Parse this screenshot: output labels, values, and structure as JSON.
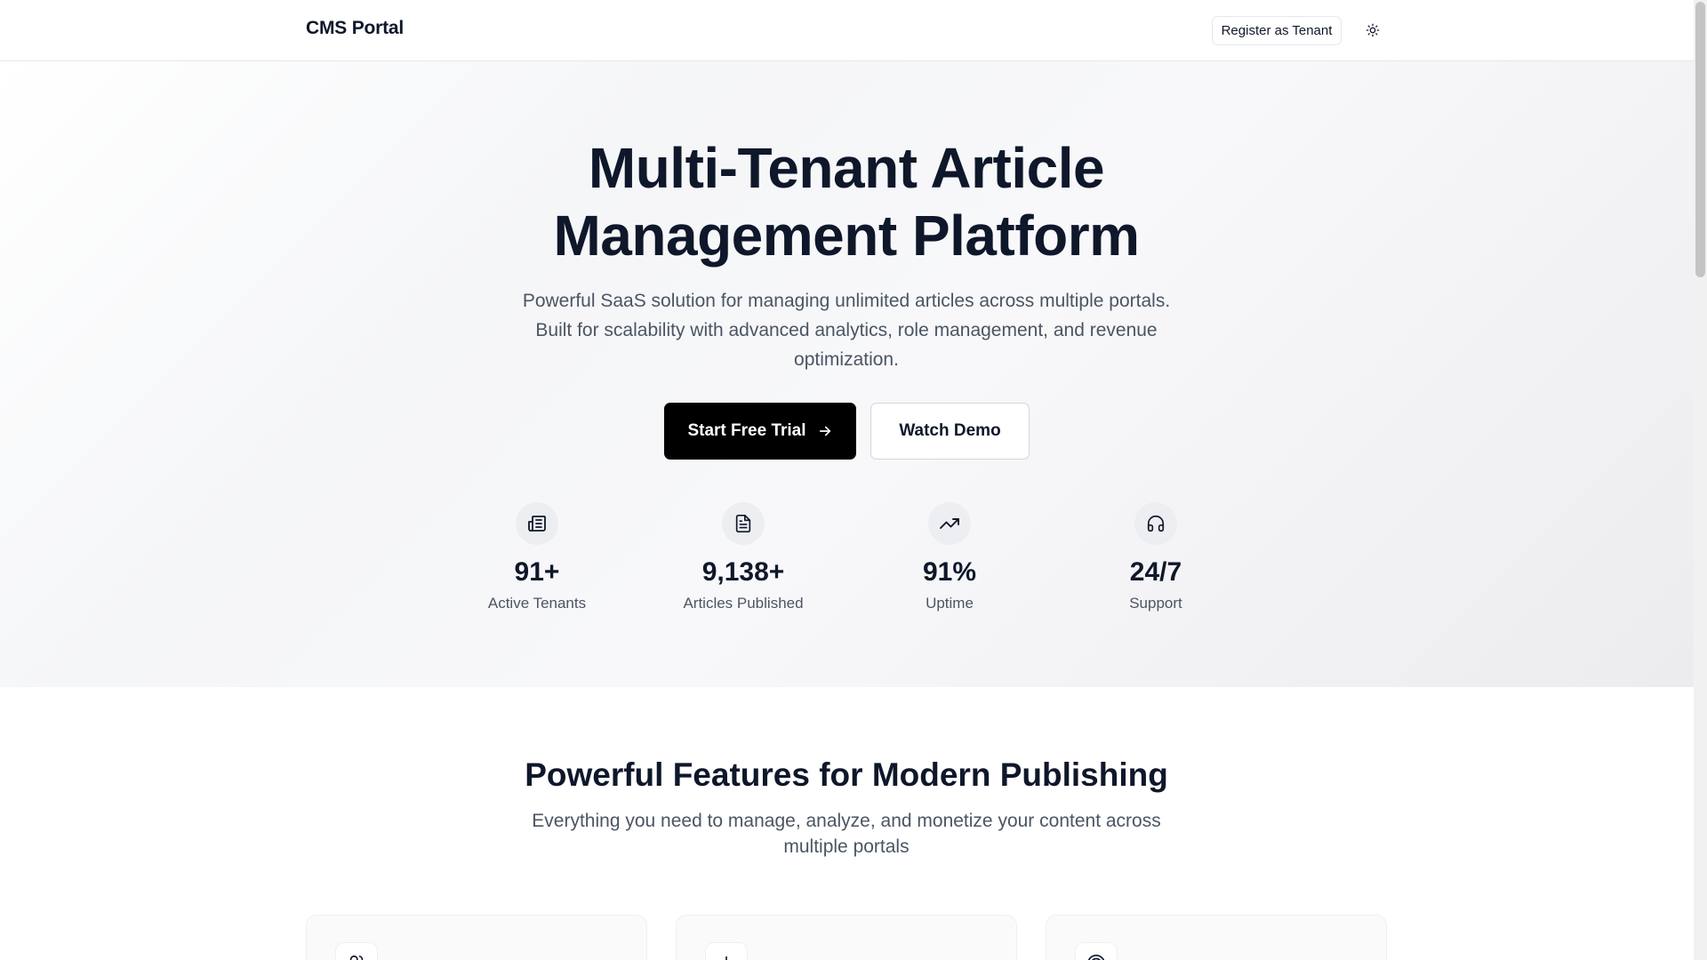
{
  "header": {
    "brand": "CMS Portal",
    "register_label": "Register as Tenant",
    "theme_icon": "sun-icon"
  },
  "hero": {
    "title_line1": "Multi-Tenant Article",
    "title_line2": "Management Platform",
    "subtitle": "Powerful SaaS solution for managing unlimited articles across multiple portals. Built for scalability with advanced analytics, role management, and revenue optimization.",
    "primary_cta": "Start Free Trial",
    "secondary_cta": "Watch Demo",
    "stats": [
      {
        "icon": "newspaper-icon",
        "value": "91+",
        "label": "Active Tenants"
      },
      {
        "icon": "document-icon",
        "value": "9,138+",
        "label": "Articles Published"
      },
      {
        "icon": "trending-up-icon",
        "value": "91%",
        "label": "Uptime"
      },
      {
        "icon": "headphones-icon",
        "value": "24/7",
        "label": "Support"
      }
    ]
  },
  "features": {
    "title": "Powerful Features for Modern Publishing",
    "subtitle": "Everything you need to manage, analyze, and monetize your content across multiple portals",
    "cards": [
      {
        "icon": "users-icon"
      },
      {
        "icon": "chart-icon"
      },
      {
        "icon": "target-icon"
      }
    ]
  },
  "colors": {
    "primary": "#000000",
    "text": "#0f172a",
    "muted": "#4b5563",
    "border": "#e5e7eb"
  }
}
